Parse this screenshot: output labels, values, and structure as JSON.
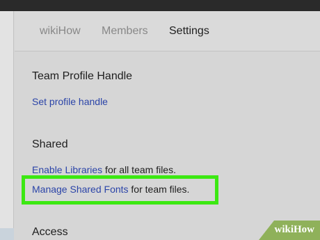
{
  "tabs": {
    "wikihow": "wikiHow",
    "members": "Members",
    "settings": "Settings"
  },
  "profile_section": {
    "heading": "Team Profile Handle",
    "link": "Set profile handle"
  },
  "shared_section": {
    "heading": "Shared",
    "libraries_link": "Enable Libraries",
    "libraries_suffix": " for all team files.",
    "fonts_link": "Manage Shared Fonts",
    "fonts_suffix": " for team files."
  },
  "access_section": {
    "heading": "Access"
  },
  "watermark": {
    "prefix": "wiki",
    "suffix": "How"
  },
  "colors": {
    "link": "#2b44a8",
    "highlight": "#3ce812",
    "topbar": "#2a2a2a",
    "background": "#d6d6d6"
  }
}
